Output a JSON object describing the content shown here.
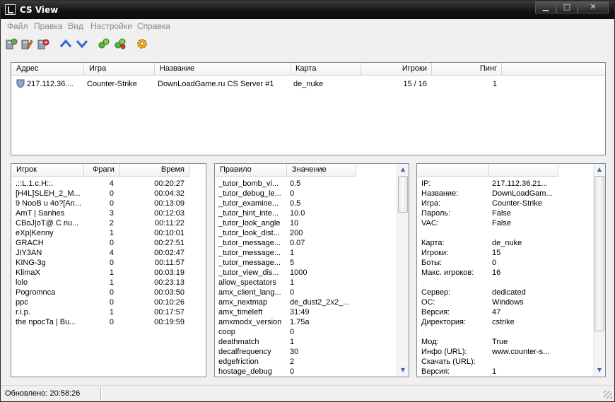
{
  "window": {
    "title": "CS View"
  },
  "menu": [
    "Файл",
    "Правка",
    "Вид",
    "Настройки",
    "Справка"
  ],
  "toolbar": [
    {
      "name": "add-server-icon",
      "color": "#6a8f3a"
    },
    {
      "name": "edit-server-icon",
      "color": "#c7832a"
    },
    {
      "name": "remove-server-icon",
      "color": "#c23b3b"
    },
    {
      "name": "move-up-icon",
      "color": "#2b66d0"
    },
    {
      "name": "move-down-icon",
      "color": "#2b66d0"
    },
    {
      "name": "refresh-icon",
      "color": "#3a9a2a"
    },
    {
      "name": "refresh-all-icon",
      "color": "#3a9a2a"
    },
    {
      "name": "settings-gear-icon",
      "color": "#e0a417"
    }
  ],
  "servers": {
    "headers": [
      "Адрес",
      "Игра",
      "Название",
      "Карта",
      "Игроки",
      "Пинг"
    ],
    "rows": [
      {
        "address": "217.112.36....",
        "game": "Counter-Strike",
        "name": "DownLoadGame.ru CS Server #1",
        "map": "de_nuke",
        "players": "15 / 16",
        "ping": "1"
      }
    ]
  },
  "players": {
    "headers": [
      "Игрок",
      "Фраги",
      "Время"
    ],
    "rows": [
      [
        ".::L.1.c.H::.",
        "4",
        "00:20:27"
      ],
      [
        "[H4L]SLEH_2_M...",
        "0",
        "00:04:32"
      ],
      [
        "9 NooB u 4o?[An...",
        "0",
        "00:13:09"
      ],
      [
        "AmT | Sanhes",
        "3",
        "00:12:03"
      ],
      [
        "CBoJ|oT@ C nu...",
        "2",
        "00:11:22"
      ],
      [
        "eXp|Kenny",
        "1",
        "00:10:01"
      ],
      [
        "GRACH",
        "0",
        "00:27:51"
      ],
      [
        "JIY3AN",
        "4",
        "00:02:47"
      ],
      [
        "KING-3g",
        "0",
        "00:11:57"
      ],
      [
        "KlimaX",
        "1",
        "00:03:19"
      ],
      [
        "lolo",
        "1",
        "00:23:13"
      ],
      [
        "Pogromnca",
        "0",
        "00:03:50"
      ],
      [
        "ppc",
        "0",
        "00:10:26"
      ],
      [
        "r.i.p.",
        "1",
        "00:17:57"
      ],
      [
        "the npocTa | Bu...",
        "0",
        "00:19:59"
      ]
    ]
  },
  "rules": {
    "headers": [
      "Правило",
      "Значение"
    ],
    "rows": [
      [
        "_tutor_bomb_vi...",
        "0.5"
      ],
      [
        "_tutor_debug_le...",
        "0"
      ],
      [
        "_tutor_examine...",
        "0.5"
      ],
      [
        "_tutor_hint_inte...",
        "10.0"
      ],
      [
        "_tutor_look_angle",
        "10"
      ],
      [
        "_tutor_look_dist...",
        "200"
      ],
      [
        "_tutor_message...",
        "0.07"
      ],
      [
        "_tutor_message...",
        "1"
      ],
      [
        "_tutor_message...",
        "5"
      ],
      [
        "_tutor_view_dis...",
        "1000"
      ],
      [
        "allow_spectators",
        "1"
      ],
      [
        "amx_client_lang...",
        "0"
      ],
      [
        "amx_nextmap",
        "de_dust2_2x2_..."
      ],
      [
        "amx_timeleft",
        "31:49"
      ],
      [
        "amxmodx_version",
        "1.75a"
      ],
      [
        "coop",
        "0"
      ],
      [
        "deathmatch",
        "1"
      ],
      [
        "decalfrequency",
        "30"
      ],
      [
        "edgefriction",
        "2"
      ],
      [
        "hostage_debug",
        "0"
      ]
    ]
  },
  "info": {
    "headers": [
      "",
      ""
    ],
    "rows": [
      [
        "IP:",
        "217.112.36.21..."
      ],
      [
        "Название:",
        "DownLoadGam..."
      ],
      [
        "Игра:",
        "Counter-Strike"
      ],
      [
        "Пароль:",
        "False"
      ],
      [
        "VAC:",
        "False"
      ],
      [
        "",
        ""
      ],
      [
        "Карта:",
        "de_nuke"
      ],
      [
        "Игроки:",
        "15"
      ],
      [
        "Боты:",
        "0"
      ],
      [
        "Макс. игроков:",
        "16"
      ],
      [
        "",
        ""
      ],
      [
        "Сервер:",
        "dedicated"
      ],
      [
        "ОС:",
        "Windows"
      ],
      [
        "Версия:",
        "47"
      ],
      [
        "Директория:",
        "cstrike"
      ],
      [
        "",
        ""
      ],
      [
        "Мод:",
        "True"
      ],
      [
        "Инфо (URL):",
        "www.counter-s..."
      ],
      [
        "Скачать (URL):",
        ""
      ],
      [
        "Версия:",
        "1"
      ]
    ]
  },
  "status": {
    "text": "Обновлено: 20:58:26"
  }
}
